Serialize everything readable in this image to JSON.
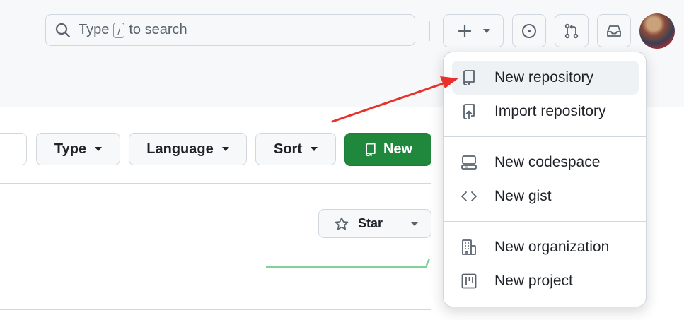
{
  "header": {
    "search": {
      "prefix": "Type",
      "key": "/",
      "suffix": "to search"
    }
  },
  "toolbar": {
    "type_label": "Type",
    "language_label": "Language",
    "sort_label": "Sort",
    "new_label": "New"
  },
  "repo": {
    "star_label": "Star"
  },
  "create_menu": {
    "items": [
      {
        "label": "New repository",
        "icon": "repo-icon"
      },
      {
        "label": "Import repository",
        "icon": "repo-push-icon"
      },
      {
        "label": "New codespace",
        "icon": "codespaces-icon"
      },
      {
        "label": "New gist",
        "icon": "code-icon"
      },
      {
        "label": "New organization",
        "icon": "organization-icon"
      },
      {
        "label": "New project",
        "icon": "project-icon"
      }
    ]
  },
  "colors": {
    "accent_green": "#1f883d",
    "annotation_arrow": "#e8312a",
    "menu_hover": "#eff2f5"
  }
}
